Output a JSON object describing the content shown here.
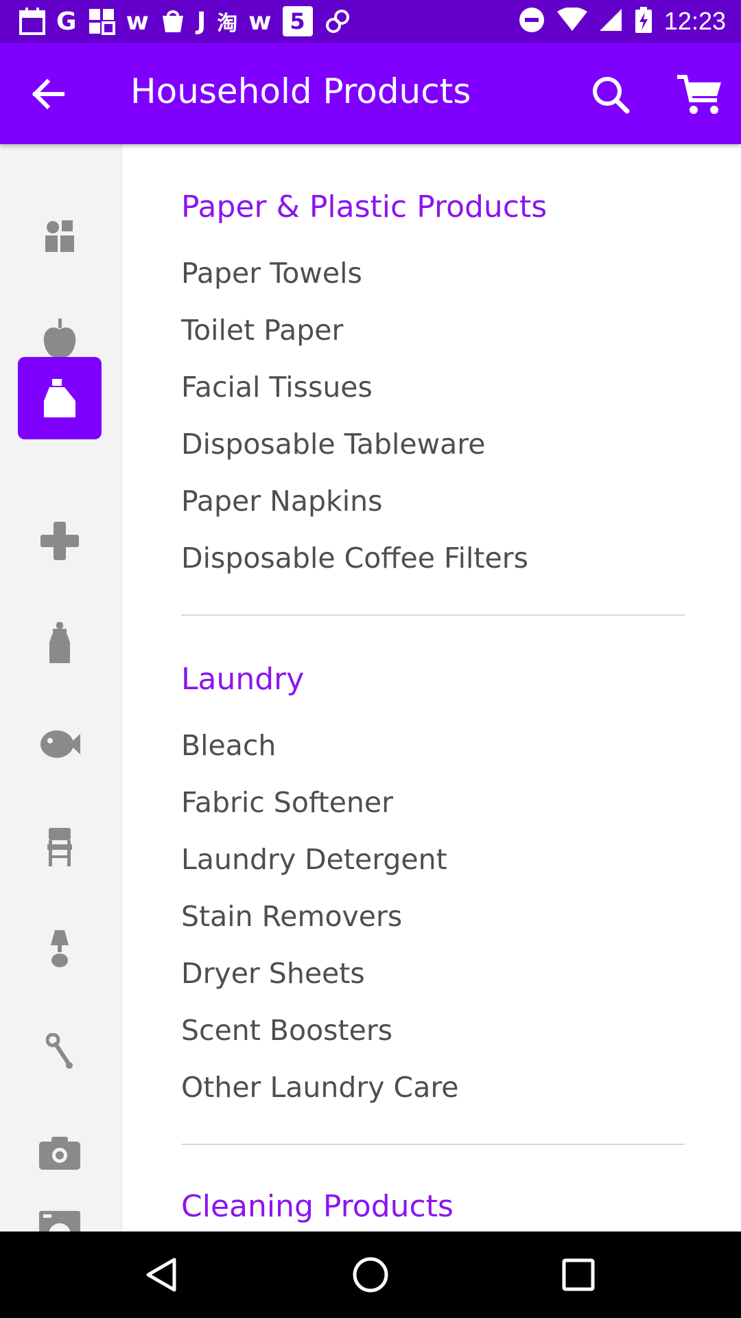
{
  "status_bar": {
    "time": "12:23",
    "notification_icons": [
      "calendar-icon",
      "google-icon",
      "grid-icon",
      "w-icon",
      "bag-icon",
      "j-icon",
      "taobao-icon",
      "w-icon",
      "five-icon",
      "link-icon"
    ],
    "letters": {
      "g": "G",
      "w": "w",
      "j": "J",
      "tao": "淘",
      "five": "5"
    }
  },
  "app_bar": {
    "title": "Household Products",
    "color": "#7f00ff"
  },
  "sidebar": {
    "active_index": 2,
    "items": [
      {
        "icon": "gift-icon"
      },
      {
        "icon": "apple-icon"
      },
      {
        "icon": "detergent-bottle-icon"
      },
      {
        "icon": "plus-cross-icon"
      },
      {
        "icon": "baby-bottle-icon"
      },
      {
        "icon": "fish-icon"
      },
      {
        "icon": "chair-icon"
      },
      {
        "icon": "lamp-icon"
      },
      {
        "icon": "wrench-icon"
      },
      {
        "icon": "camera-icon"
      },
      {
        "icon": "washing-machine-icon"
      }
    ]
  },
  "sections": [
    {
      "title": "Paper & Plastic Products",
      "items": [
        "Paper Towels",
        "Toilet Paper",
        "Facial Tissues",
        "Disposable Tableware",
        "Paper Napkins",
        "Disposable Coffee Filters"
      ]
    },
    {
      "title": "Laundry",
      "items": [
        "Bleach",
        "Fabric Softener",
        "Laundry Detergent",
        "Stain Removers",
        "Dryer Sheets",
        "Scent Boosters",
        "Other Laundry Care"
      ]
    },
    {
      "title": "Cleaning Products",
      "items": []
    }
  ],
  "colors": {
    "accent": "#7f00ff",
    "section_title": "#8b14ef",
    "item_text": "#4e4e4e",
    "status_bar": "#6400cc",
    "sidebar_icon": "#8a8a8a"
  }
}
